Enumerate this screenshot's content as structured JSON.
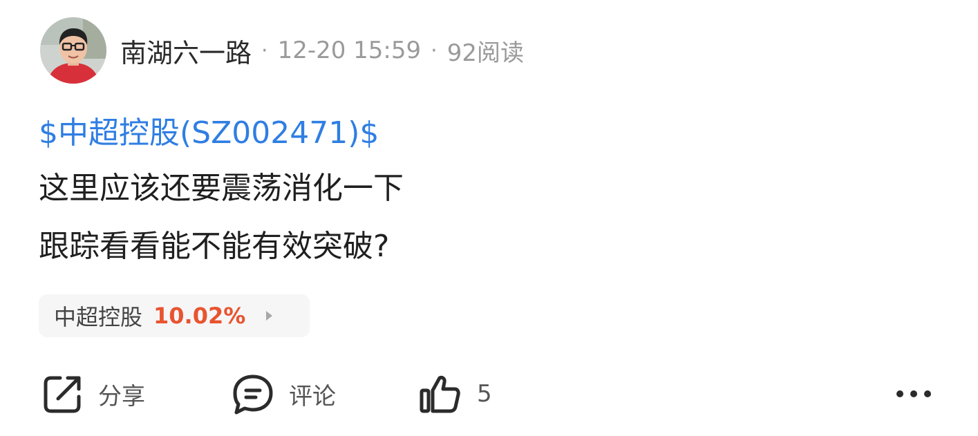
{
  "post": {
    "author": "南湖六一路",
    "time": "12-20 15:59",
    "reads": "92阅读",
    "stock_link": "$中超控股(SZ002471)$",
    "lines": [
      "这里应该还要震荡消化一下",
      "跟踪看看能不能有效突破?"
    ],
    "chip": {
      "name": "中超控股",
      "change": "10.02%"
    }
  },
  "actions": {
    "share_label": "分享",
    "comment_label": "评论",
    "like_count": "5"
  },
  "colors": {
    "link": "#2f7ee3",
    "rise": "#e8542f",
    "muted": "#9a9a9a"
  },
  "icons": {
    "avatar": "user-avatar",
    "share": "share-icon",
    "comment": "comment-icon",
    "like": "thumbs-up-icon",
    "more": "more-icon"
  }
}
